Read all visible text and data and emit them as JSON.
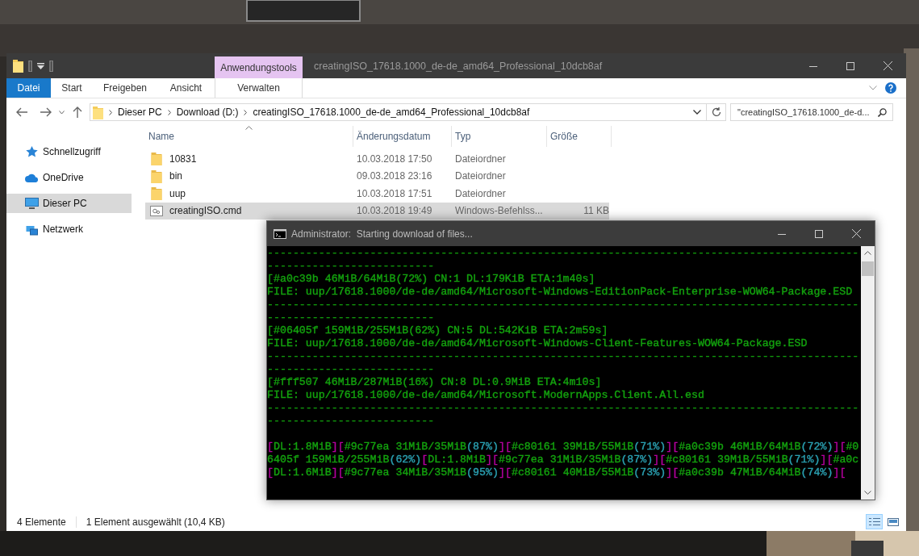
{
  "explorer": {
    "title": "creatingISO_17618.1000_de-de_amd64_Professional_10dcb8af",
    "context_group": "Anwendungstools",
    "ribbon_tabs": [
      {
        "label": "Datei",
        "kind": "file"
      },
      {
        "label": "Start",
        "kind": "tab"
      },
      {
        "label": "Freigeben",
        "kind": "tab"
      },
      {
        "label": "Ansicht",
        "kind": "tab"
      },
      {
        "label": "Verwalten",
        "kind": "context"
      }
    ],
    "breadcrumbs": [
      "Dieser PC",
      "Download (D:)",
      "creatingISO_17618.1000_de-de_amd64_Professional_10dcb8af"
    ],
    "search": {
      "value": "\"creatingISO_17618.1000_de-d..."
    },
    "sidebar": {
      "items": [
        {
          "label": "Schnellzugriff",
          "kind": "star",
          "selected": false
        },
        {
          "label": "OneDrive",
          "kind": "cloud",
          "selected": false
        },
        {
          "label": "Dieser PC",
          "kind": "pc",
          "selected": true
        },
        {
          "label": "Netzwerk",
          "kind": "network",
          "selected": false
        }
      ]
    },
    "table": {
      "columns": [
        {
          "label": "Name",
          "sorted": true
        },
        {
          "label": "Änderungsdatum",
          "sorted": false
        },
        {
          "label": "Typ",
          "sorted": false
        },
        {
          "label": "Größe",
          "sorted": false
        }
      ],
      "rows": [
        {
          "name": "10831",
          "kind": "folder",
          "date": "10.03.2018 17:50",
          "type": "Dateiordner",
          "selected": false
        },
        {
          "name": "bin",
          "kind": "folder",
          "date": "09.03.2018 23:16",
          "type": "Dateiordner",
          "selected": false
        },
        {
          "name": "uup",
          "kind": "folder",
          "date": "10.03.2018 17:51",
          "type": "Dateiordner",
          "selected": false
        },
        {
          "name": "creatingISO.cmd",
          "kind": "script",
          "date": "10.03.2018 19:49",
          "type": "Windows-Befehlss...",
          "size": "11 KB",
          "selected": true
        }
      ]
    },
    "status_bar": {
      "items": [
        "4 Elemente",
        "1 Element ausgewählt (10,4 KB)"
      ],
      "views": [
        {
          "kind": "details",
          "selected": true
        },
        {
          "kind": "tiles",
          "selected": false
        }
      ]
    }
  },
  "console": {
    "title": "Administrator:  Starting download of files...",
    "lines": [
      {
        "text": "--------------------------------------------------------------------------------------------"
      },
      {
        "text": "--------------------------"
      },
      {
        "text": "[#a0c39b 46MiB/64MiB(72%) CN:1 DL:179KiB ETA:1m40s]"
      },
      {
        "text": "FILE: uup/17618.1000/de-de/amd64/Microsoft-Windows-EditionPack-Enterprise-WOW64-Package.ESD"
      },
      {
        "text": "--------------------------------------------------------------------------------------------"
      },
      {
        "text": "--------------------------"
      },
      {
        "text": "[#06405f 159MiB/255MiB(62%) CN:5 DL:542KiB ETA:2m59s]"
      },
      {
        "text": "FILE: uup/17618.1000/de-de/amd64/Microsoft-Windows-Client-Features-WOW64-Package.ESD"
      },
      {
        "text": "--------------------------------------------------------------------------------------------"
      },
      {
        "text": "--------------------------"
      },
      {
        "text": "[#fff507 46MiB/287MiB(16%) CN:8 DL:0.9MiB ETA:4m10s]"
      },
      {
        "text": "FILE: uup/17618.1000/de-de/amd64/Microsoft.ModernApps.Client.All.esd"
      },
      {
        "text": "--------------------------------------------------------------------------------------------"
      },
      {
        "text": "--------------------------"
      },
      {
        "kind": "blank"
      },
      {
        "segments": [
          {
            "text": "[",
            "color": "#b4009e"
          },
          {
            "text": "DL:1.8MiB",
            "color": "#13a10e"
          },
          {
            "text": "][",
            "color": "#b4009e"
          },
          {
            "text": "#9c77ea 31MiB/35MiB",
            "color": "#13a10e"
          },
          {
            "text": "(87%)",
            "color": "#2a9fb0"
          },
          {
            "text": "][",
            "color": "#b4009e"
          },
          {
            "text": "#c80161 39MiB/55MiB",
            "color": "#13a10e"
          },
          {
            "text": "(71%)",
            "color": "#2a9fb0"
          },
          {
            "text": "][",
            "color": "#b4009e"
          },
          {
            "text": "#a0c39b 46MiB/64MiB",
            "color": "#13a10e"
          },
          {
            "text": "(72%)",
            "color": "#2a9fb0"
          },
          {
            "text": "][",
            "color": "#b4009e"
          },
          {
            "text": "#0",
            "color": "#13a10e"
          }
        ]
      },
      {
        "segments": [
          {
            "text": "6405f 159MiB/255MiB",
            "color": "#13a10e"
          },
          {
            "text": "(62%)",
            "color": "#2a9fb0"
          },
          {
            "text": "[",
            "color": "#b4009e"
          },
          {
            "text": "DL:1.8MiB",
            "color": "#13a10e"
          },
          {
            "text": "][",
            "color": "#b4009e"
          },
          {
            "text": "#9c77ea 31MiB/35MiB",
            "color": "#13a10e"
          },
          {
            "text": "(87%)",
            "color": "#2a9fb0"
          },
          {
            "text": "][",
            "color": "#b4009e"
          },
          {
            "text": "#c80161 39MiB/55MiB",
            "color": "#13a10e"
          },
          {
            "text": "(71%)",
            "color": "#2a9fb0"
          },
          {
            "text": "][",
            "color": "#b4009e"
          },
          {
            "text": "#a0c",
            "color": "#13a10e"
          }
        ]
      },
      {
        "segments": [
          {
            "text": "[",
            "color": "#b4009e"
          },
          {
            "text": "DL:1.6MiB",
            "color": "#13a10e"
          },
          {
            "text": "][",
            "color": "#b4009e"
          },
          {
            "text": "#9c77ea 34MiB/35MiB",
            "color": "#13a10e"
          },
          {
            "text": "(95%)",
            "color": "#2a9fb0"
          },
          {
            "text": "][",
            "color": "#b4009e"
          },
          {
            "text": "#c80161 40MiB/55MiB",
            "color": "#13a10e"
          },
          {
            "text": "(73%)",
            "color": "#2a9fb0"
          },
          {
            "text": "][",
            "color": "#b4009e"
          },
          {
            "text": "#a0c39b 47MiB/64MiB",
            "color": "#13a10e"
          },
          {
            "text": "(74%)",
            "color": "#2a9fb0"
          },
          {
            "text": "][",
            "color": "#b4009e"
          }
        ]
      }
    ]
  }
}
